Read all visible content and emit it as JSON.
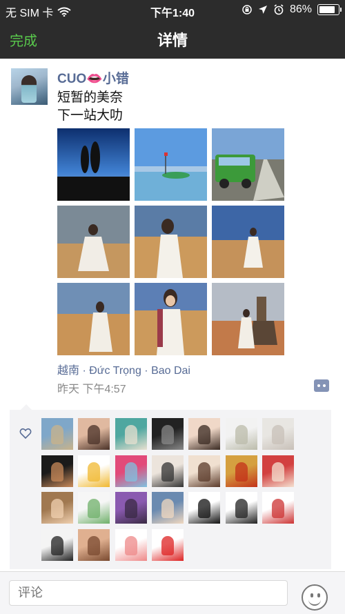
{
  "status_bar": {
    "carrier": "无 SIM 卡",
    "time": "下午1:40",
    "battery": "86%",
    "battery_level": 0.86
  },
  "nav": {
    "done_label": "完成",
    "title": "详情"
  },
  "post": {
    "username": "CUO👄小错",
    "text_lines": [
      "短暂的美奈",
      "下一站大叻"
    ],
    "location": "越南 · Đức Trọng · Bao Dai",
    "time": "昨天 下午4:57",
    "photos": [
      "silhouette-couple",
      "boat-on-beach",
      "green-jeep",
      "girl-dunes-1",
      "girl-dunes-2",
      "girl-dunes-3",
      "girl-dunes-4",
      "girl-dunes-5",
      "girl-dunes-6"
    ]
  },
  "likes": {
    "count": 25
  },
  "bottom": {
    "comment_placeholder": "评论"
  },
  "colors": {
    "nav_background": "#2c2c2c",
    "done_green": "#59c94c",
    "link_blue": "#576b95",
    "likes_background": "#f3f3f5"
  }
}
